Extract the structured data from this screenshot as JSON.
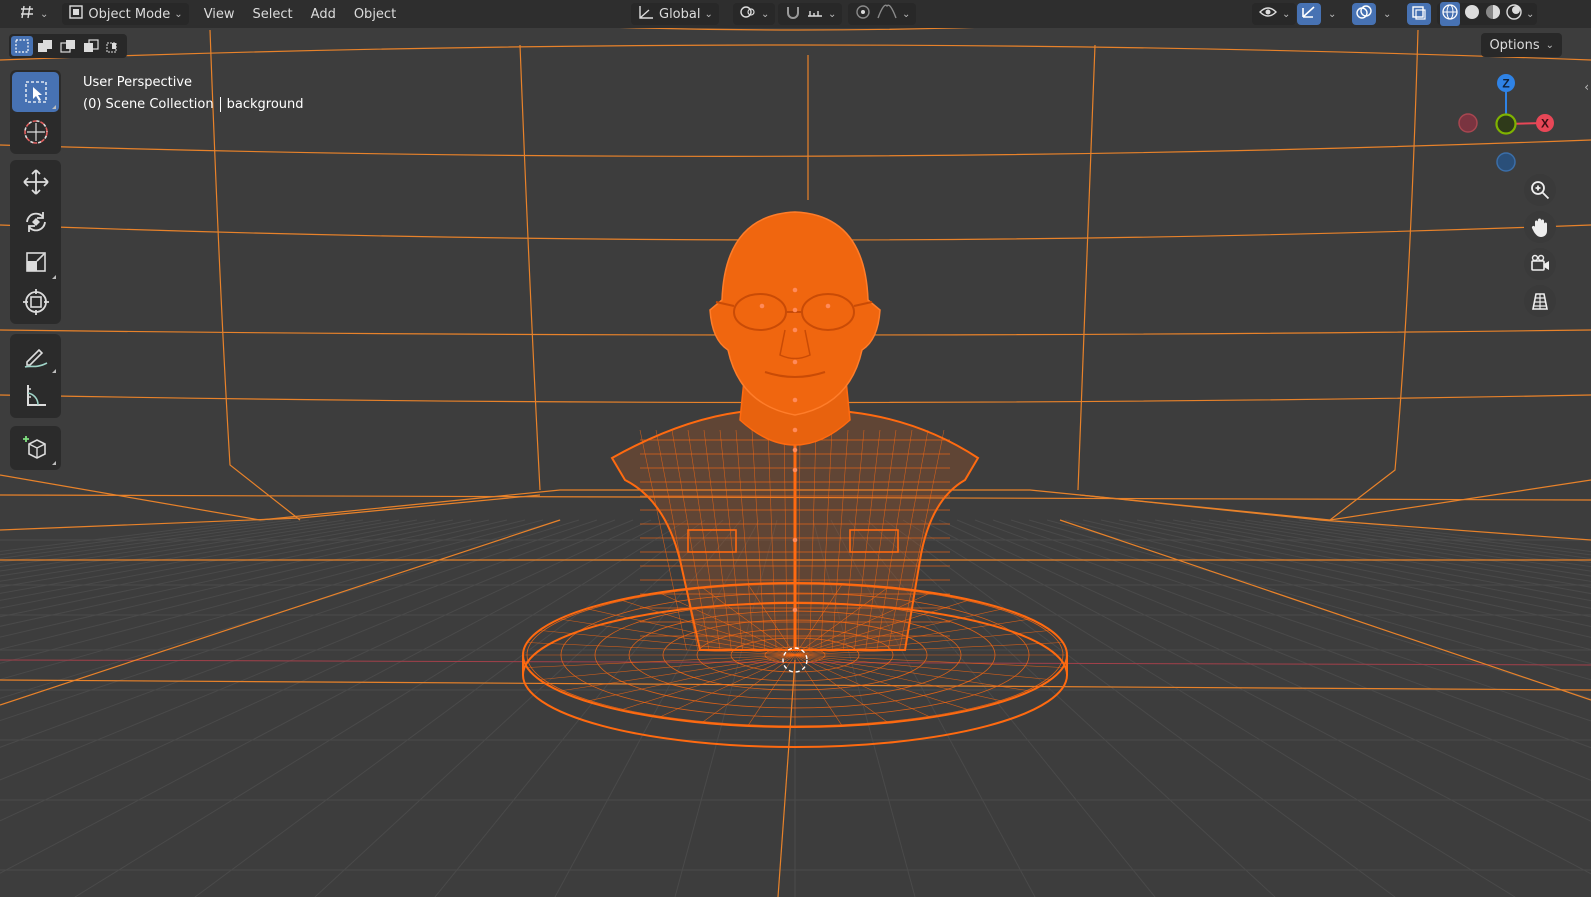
{
  "header": {
    "editor_type_icon": "viewport-editor-icon",
    "mode_label": "Object Mode",
    "menus": [
      "View",
      "Select",
      "Add",
      "Object"
    ],
    "transform_orientation": "Global",
    "pivot_icon": "pivot-point-icon",
    "snap_icon": "snap-magnet-icon",
    "snap_target_icon": "snap-increment-icon",
    "proportional_icon": "proportional-edit-icon",
    "falloff_icon": "falloff-curve-icon",
    "visibility_icon": "visibility-eye-icon",
    "gizmo_icon": "gizmo-toggle-icon",
    "overlay_icon": "overlays-icon",
    "xray_icon": "xray-toggle-icon",
    "shading_modes": [
      "wireframe-shading-icon",
      "solid-shading-icon",
      "material-shading-icon",
      "rendered-shading-icon"
    ]
  },
  "select_modes": [
    "select-new-icon",
    "select-extend-icon",
    "select-subtract-icon",
    "select-invert-icon",
    "select-intersect-icon"
  ],
  "options_label": "Options",
  "toolbar": {
    "tools": [
      {
        "name": "select-box-icon",
        "active": true
      },
      {
        "name": "cursor-icon",
        "active": false
      },
      {
        "name": "move-icon",
        "active": false
      },
      {
        "name": "rotate-icon",
        "active": false
      },
      {
        "name": "scale-icon",
        "active": false
      },
      {
        "name": "transform-icon",
        "active": false
      },
      {
        "name": "annotate-icon",
        "active": false
      },
      {
        "name": "measure-icon",
        "active": false
      },
      {
        "name": "add-cube-icon",
        "active": false
      }
    ]
  },
  "viewport": {
    "view_name": "User Perspective",
    "collection": "(0) Scene Collection",
    "active_object": "background",
    "gizmo_axes": {
      "z": "Z",
      "x": "X"
    },
    "axis_colors": {
      "x": "#e84757",
      "y": "#7fb300",
      "z": "#2f83e6"
    },
    "wire_color": "#e8822a",
    "selected_color": "#ff6a10"
  },
  "nav_buttons": [
    "zoom-icon",
    "pan-hand-icon",
    "camera-view-icon",
    "ortho-grid-icon"
  ]
}
